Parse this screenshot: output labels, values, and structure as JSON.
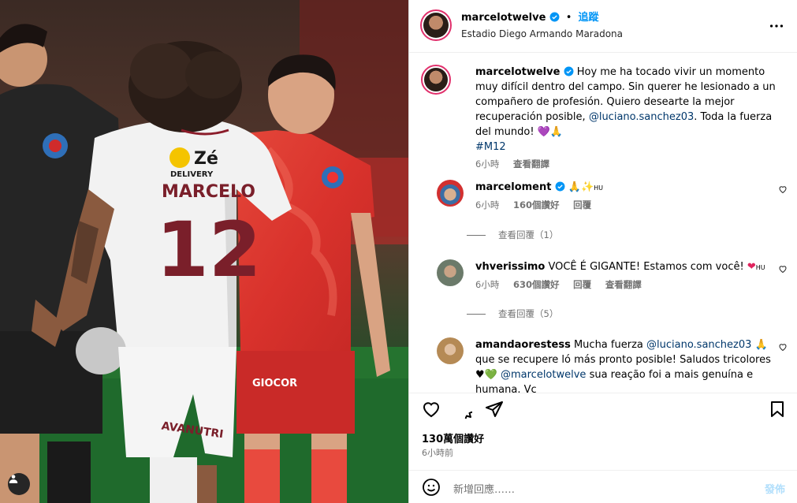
{
  "post": {
    "author": "marcelotwelve",
    "follow_label": "追蹤",
    "location": "Estadio Diego Armando Maradona",
    "caption_text": "Hoy me ha tocado vivir un momento muy difícil dentro del campo. Sin querer he lesionado a un compañero de profesión. Quiero desearte la mejor recuperación posible,",
    "caption_mention": "@luciano.sanchez03",
    "caption_tail": ". Toda la fuerza del mundo! 💜🙏",
    "caption_hashtag": "#M12",
    "caption_time": "6小時",
    "caption_translate": "查看翻譯",
    "jersey_sponsor": "Zé",
    "jersey_sponsor_sub": "DELIVERY",
    "jersey_name": "MARCELO",
    "jersey_number": "12",
    "shorts_text": "AVANUTRI",
    "opponent_sponsor": "GIOCOR"
  },
  "comments": [
    {
      "username": "marceloment",
      "text": "🙏✨",
      "text_suffix": "HU",
      "time": "6小時",
      "likes": "160個讚好",
      "reply": "回覆",
      "translate": "",
      "view_replies": "查看回覆（1）"
    },
    {
      "username": "vhverissimo",
      "text": "VOCÊ É GIGANTE! Estamos com você! ",
      "text_suffix": "HU",
      "time": "6小時",
      "likes": "630個讚好",
      "reply": "回覆",
      "translate": "查看翻譯",
      "view_replies": "查看回覆（5）"
    },
    {
      "username": "amandaorestess",
      "text_before": "Mucha fuerza",
      "mention": "@luciano.sanchez03",
      "text_after": "🙏 que se recupere ló más pronto posible! Saludos tricolores ♥💚",
      "mention2": "@marcelotwelve",
      "text_end": "sua reação foi a mais genuína e humana. Vc"
    }
  ],
  "footer": {
    "likes": "130萬個讚好",
    "time": "6小時前",
    "add_comment_placeholder": "新增回應……",
    "post_label": "發佈"
  },
  "colors": {
    "link": "#0095f6",
    "mention": "#00376b",
    "muted": "#737373",
    "verified": "#0095f6"
  }
}
